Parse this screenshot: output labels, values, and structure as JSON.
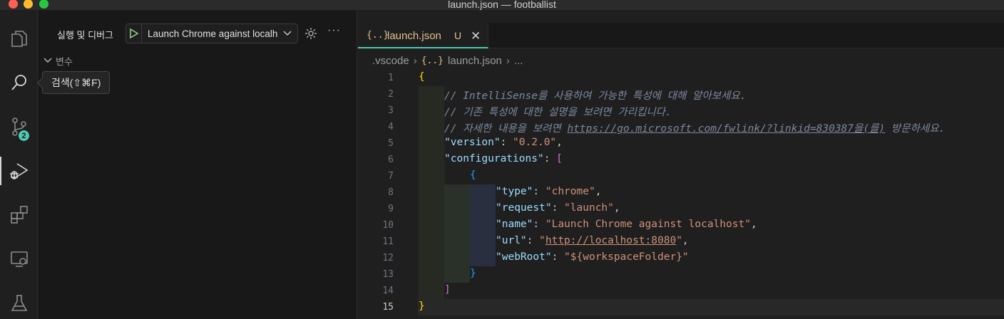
{
  "window": {
    "title": "launch.json — footballist"
  },
  "activity_bar": {
    "items": [
      {
        "name": "explorer"
      },
      {
        "name": "search"
      },
      {
        "name": "source-control",
        "badge": "2"
      },
      {
        "name": "run-and-debug"
      },
      {
        "name": "extensions"
      },
      {
        "name": "remote-explorer"
      },
      {
        "name": "testing"
      }
    ],
    "tooltip": "검색(⇧⌘F)"
  },
  "sidebar": {
    "title": "실행 및 디버그",
    "launch_config": "Launch Chrome against localhost",
    "section_variables": "변수"
  },
  "editor": {
    "tab": {
      "icon_text": "{..}",
      "label": "launch.json",
      "status": "U"
    },
    "breadcrumb": {
      "folder": ".vscode",
      "file": "launch.json",
      "more": "..."
    },
    "lines": [
      {
        "num": "1",
        "text": "{"
      },
      {
        "num": "2",
        "text": "// IntelliSense를 사용하여 가능한 특성에 대해 알아보세요."
      },
      {
        "num": "3",
        "text": "// 기존 특성에 대한 설명을 보려면 가리킵니다."
      },
      {
        "num": "4",
        "text": "// 자세한 내용을 보려면 https://go.microsoft.com/fwlink/?linkid=830387을(를) 방문하세요."
      },
      {
        "num": "5",
        "text": "\"version\": \"0.2.0\","
      },
      {
        "num": "6",
        "text": "\"configurations\": ["
      },
      {
        "num": "7",
        "text": "{"
      },
      {
        "num": "8",
        "text": "\"type\": \"chrome\","
      },
      {
        "num": "9",
        "text": "\"request\": \"launch\","
      },
      {
        "num": "10",
        "text": "\"name\": \"Launch Chrome against localhost\","
      },
      {
        "num": "11",
        "text": "\"url\": \"http://localhost:8080\","
      },
      {
        "num": "12",
        "text": "\"webRoot\": \"${workspaceFolder}\""
      },
      {
        "num": "13",
        "text": "}"
      },
      {
        "num": "14",
        "text": "]"
      },
      {
        "num": "15",
        "text": "}"
      }
    ],
    "current_line": "15"
  },
  "code_tokens": {
    "l2": "// IntelliSense를 사용하여 가능한 특성에 대해 알아보세요.",
    "l3": "// 기존 특성에 대한 설명을 보려면 가리킵니다.",
    "l4_pre": "// 자세한 내용을 보려면 ",
    "l4_link": "https://go.microsoft.com/fwlink/?linkid=830387을(를)",
    "l4_post": " 방문하세요.",
    "version_key": "\"version\"",
    "version_val": "\"0.2.0\"",
    "configurations_key": "\"configurations\"",
    "type_key": "\"type\"",
    "type_val": "\"chrome\"",
    "request_key": "\"request\"",
    "request_val": "\"launch\"",
    "name_key": "\"name\"",
    "name_val": "\"Launch Chrome against localhost\"",
    "url_key": "\"url\"",
    "url_q": "\"",
    "url_val": "http://localhost:8080",
    "webroot_key": "\"webRoot\"",
    "webroot_val": "\"${workspaceFolder}\""
  },
  "colors": {
    "accent": "#4ec9b0",
    "modified_file": "#e2c08d",
    "string": "#ce9178",
    "key": "#9cdcfe",
    "brace_level1": "#ffd700",
    "bracket_level2": "#da70d6",
    "brace_level3": "#179fff"
  }
}
